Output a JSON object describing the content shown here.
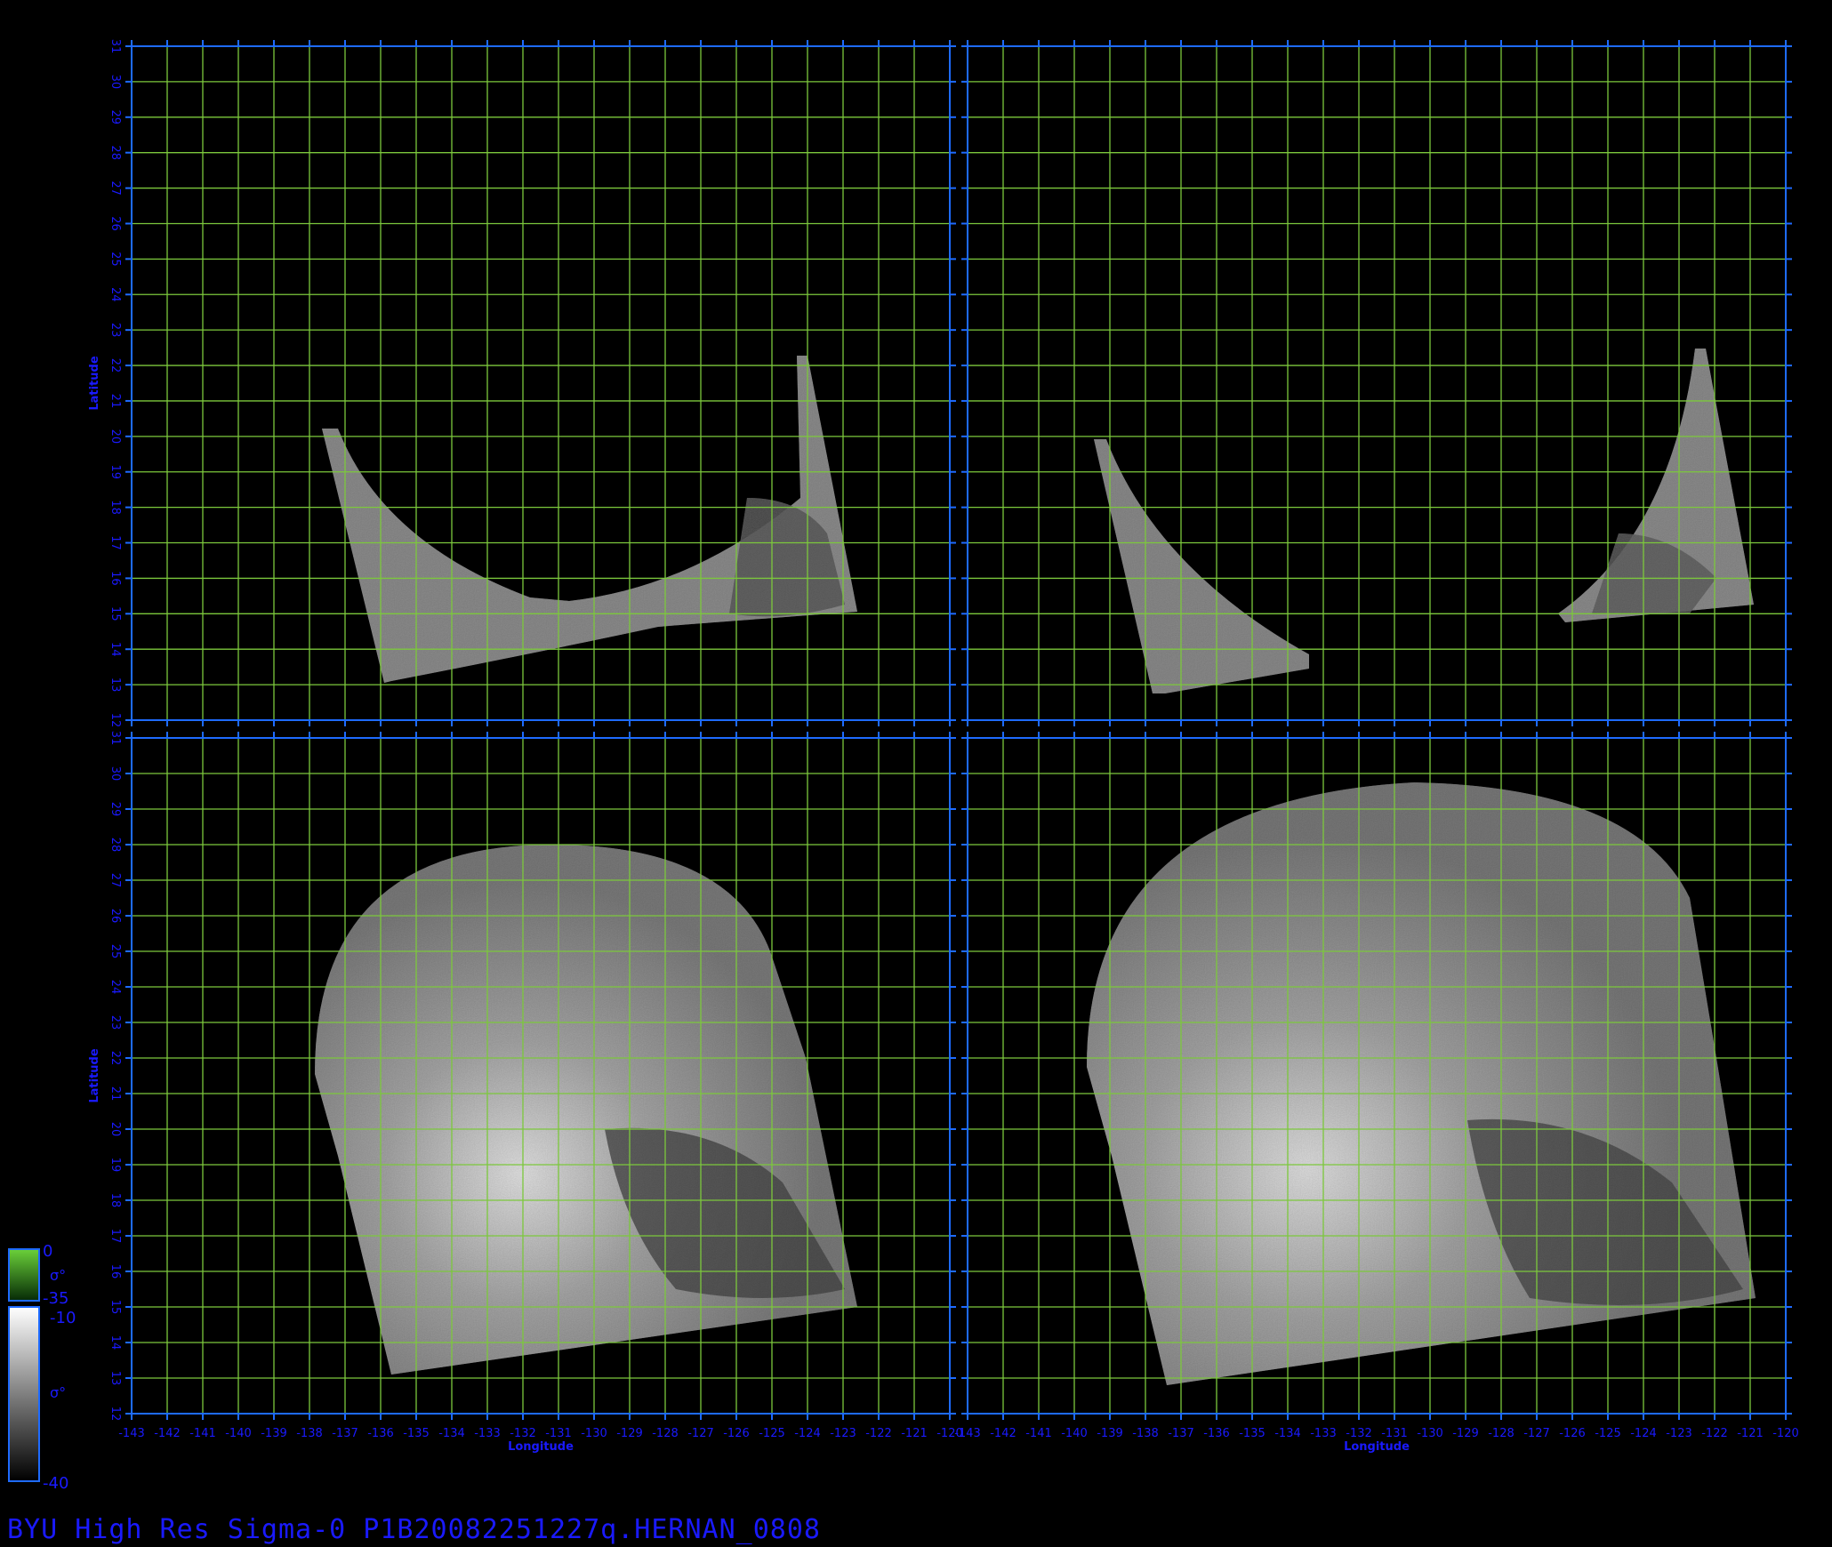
{
  "footer_title": "BYU High Res Sigma-0 P1B20082251227q.HERNAN_0808",
  "axes": {
    "xlabel": "Longitude",
    "ylabel": "Latitude",
    "lon_ticks": [
      "-143",
      "-142",
      "-141",
      "-140",
      "-139",
      "-138",
      "-137",
      "-136",
      "-135",
      "-134",
      "-133",
      "-132",
      "-131",
      "-130",
      "-129",
      "-128",
      "-127",
      "-126",
      "-125",
      "-124",
      "-123",
      "-122",
      "-121",
      "-120"
    ],
    "lat_ticks": [
      "12",
      "13",
      "14",
      "15",
      "16",
      "17",
      "18",
      "19",
      "20",
      "21",
      "22",
      "23",
      "24",
      "25",
      "26",
      "27",
      "28",
      "29",
      "30",
      "31"
    ]
  },
  "colorbars": {
    "green": {
      "max": "0",
      "min": "-35",
      "unit": "σ°"
    },
    "gray": {
      "max": "-10",
      "min": "-40",
      "unit": "σ°"
    }
  },
  "colors": {
    "background": "#000000",
    "frame": "#1e6bff",
    "grid": "#7cc83c",
    "text": "#1a1aff"
  },
  "panels": [
    {
      "name": "upper-left"
    },
    {
      "name": "upper-right"
    },
    {
      "name": "lower-left"
    },
    {
      "name": "lower-right"
    }
  ]
}
